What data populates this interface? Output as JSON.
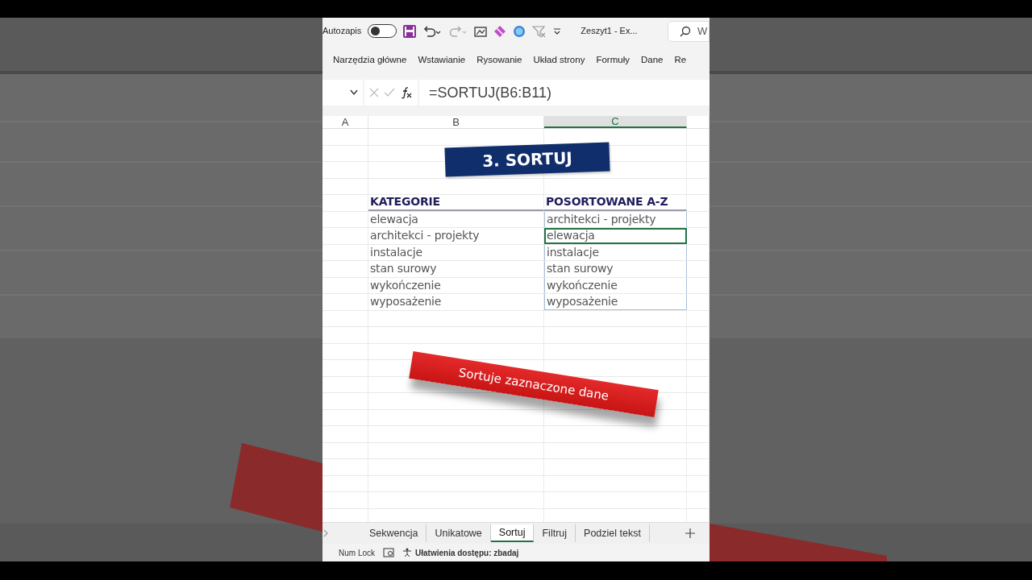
{
  "title_bar": {
    "autosave_label": "Autozapis",
    "autosave_on": false,
    "document_title": "Zeszyt1  -  Ex...",
    "search_text": "W"
  },
  "ribbon_tabs": [
    {
      "label": "Narzędzia główne",
      "selected": false
    },
    {
      "label": "Wstawianie",
      "selected": false
    },
    {
      "label": "Rysowanie",
      "selected": false
    },
    {
      "label": "Układ strony",
      "selected": false
    },
    {
      "label": "Formuły",
      "selected": false
    },
    {
      "label": "Dane",
      "selected": false
    },
    {
      "label": "Re",
      "selected": false
    }
  ],
  "formula_bar": {
    "formula": "=SORTUJ(B6:B11)"
  },
  "columns": [
    {
      "label": "A",
      "selected": false
    },
    {
      "label": "B",
      "selected": false
    },
    {
      "label": "C",
      "selected": true
    }
  ],
  "title_banner": "3. SORTUJ",
  "table": {
    "headers": [
      "KATEGORIE",
      "POSORTOWANE A-Z"
    ],
    "rows": [
      {
        "column_b": "elewacja",
        "column_c": "architekci - projekty",
        "selected": false
      },
      {
        "column_b": "architekci - projekty",
        "column_c": "elewacja",
        "selected": true
      },
      {
        "column_b": "instalacje",
        "column_c": "instalacje",
        "selected": false
      },
      {
        "column_b": "stan surowy",
        "column_c": "stan surowy",
        "selected": false
      },
      {
        "column_b": "wykończenie",
        "column_c": "wykończenie",
        "selected": false
      },
      {
        "column_b": "wyposażenie",
        "column_c": "wyposażenie",
        "selected": false
      }
    ]
  },
  "callout": "Sortuje zaznaczone dane",
  "sheet_tabs": [
    {
      "label": "Sekwencja",
      "selected": false
    },
    {
      "label": "Unikatowe",
      "selected": false
    },
    {
      "label": "Sortuj",
      "selected": true
    },
    {
      "label": "Filtruj",
      "selected": false
    },
    {
      "label": "Podziel tekst",
      "selected": false
    }
  ],
  "status_bar": {
    "items": [
      "Num Lock",
      "Ułatwienia dostępu: zbadaj"
    ]
  }
}
